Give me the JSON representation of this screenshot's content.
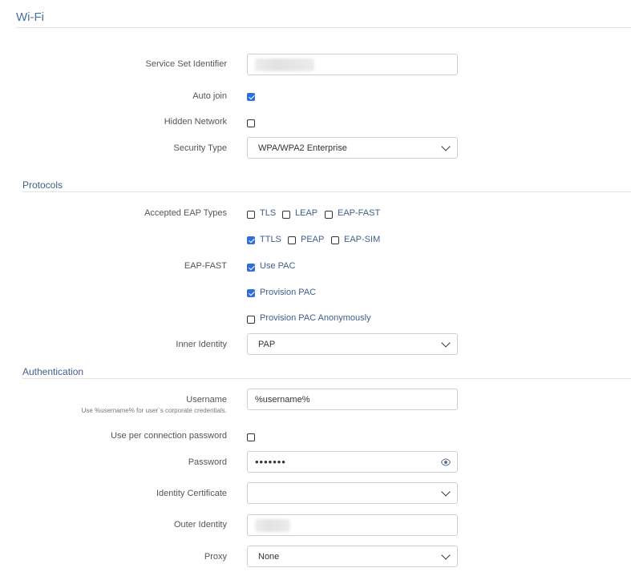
{
  "page": {
    "title": "Wi-Fi"
  },
  "general": {
    "ssid_label": "Service Set Identifier",
    "ssid_value": "",
    "auto_join_label": "Auto join",
    "auto_join_checked": true,
    "hidden_network_label": "Hidden Network",
    "hidden_network_checked": false,
    "security_type_label": "Security Type",
    "security_type_value": "WPA/WPA2 Enterprise"
  },
  "protocols": {
    "section_title": "Protocols",
    "eap_types_label": "Accepted EAP Types",
    "eap_types": [
      {
        "label": "TLS",
        "checked": false
      },
      {
        "label": "LEAP",
        "checked": false
      },
      {
        "label": "EAP-FAST",
        "checked": false
      },
      {
        "label": "TTLS",
        "checked": true
      },
      {
        "label": "PEAP",
        "checked": false
      },
      {
        "label": "EAP-SIM",
        "checked": false
      }
    ],
    "eap_fast_label": "EAP-FAST",
    "eap_fast_options": [
      {
        "label": "Use PAC",
        "checked": true
      },
      {
        "label": "Provision PAC",
        "checked": true
      },
      {
        "label": "Provision PAC Anonymously",
        "checked": false
      }
    ],
    "inner_identity_label": "Inner Identity",
    "inner_identity_value": "PAP"
  },
  "authentication": {
    "section_title": "Authentication",
    "username_label": "Username",
    "username_hint": "Use %username% for user`s corporate credentials.",
    "username_value": "%username%",
    "per_connection_password_label": "Use per connection password",
    "per_connection_password_checked": false,
    "password_label": "Password",
    "password_value": "•••••••",
    "identity_certificate_label": "Identity Certificate",
    "identity_certificate_value": "",
    "outer_identity_label": "Outer Identity",
    "outer_identity_value": "",
    "proxy_label": "Proxy",
    "proxy_value": "None"
  },
  "icons": {
    "dropdown": "chevron-down-icon",
    "reveal_password": "eye-icon",
    "checkbox_checked": "checkmark-icon"
  },
  "colors": {
    "accent": "#2f6fd8",
    "title": "#4a6fa5",
    "section": "#3f5e8c",
    "option_text": "#3f5e8c"
  }
}
